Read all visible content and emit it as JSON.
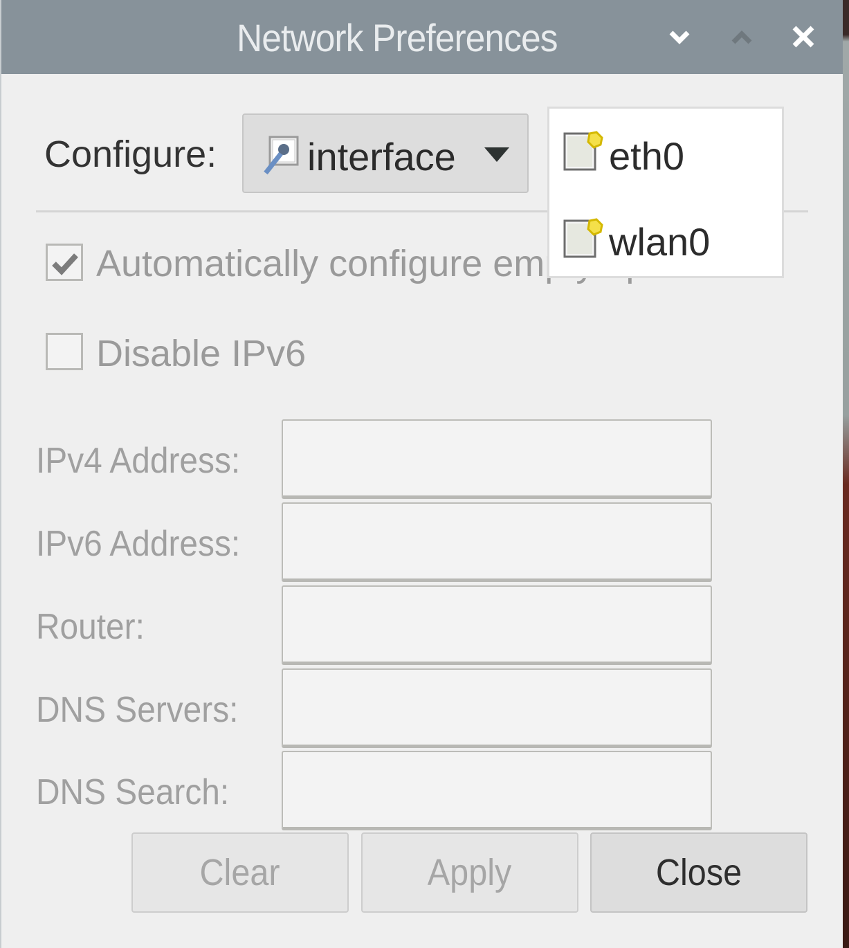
{
  "window": {
    "title": "Network Preferences",
    "controls": {
      "minimize": "chevron-down",
      "maximize": "chevron-up",
      "close": "close-x"
    }
  },
  "configure": {
    "label": "Configure:",
    "selected": "interface",
    "icon": "network-interface-icon"
  },
  "popup": {
    "items": [
      {
        "label": "eth0",
        "icon": "network-device-icon"
      },
      {
        "label": "wlan0",
        "icon": "network-device-icon"
      }
    ]
  },
  "options": {
    "auto_configure": {
      "label": "Automatically configure empty options",
      "checked": true,
      "enabled": false
    },
    "disable_ipv6": {
      "label": "Disable IPv6",
      "checked": false,
      "enabled": false
    }
  },
  "fields": [
    {
      "label": "IPv4 Address:",
      "value": ""
    },
    {
      "label": "IPv6 Address:",
      "value": ""
    },
    {
      "label": "Router:",
      "value": ""
    },
    {
      "label": "DNS Servers:",
      "value": ""
    },
    {
      "label": "DNS Search:",
      "value": ""
    }
  ],
  "buttons": {
    "clear": "Clear",
    "apply": "Apply",
    "close": "Close"
  },
  "colors": {
    "titlebar": "#87929a",
    "window_bg": "#efefef",
    "disabled_text": "#a0a0a0",
    "popup_bg": "#ffffff"
  }
}
